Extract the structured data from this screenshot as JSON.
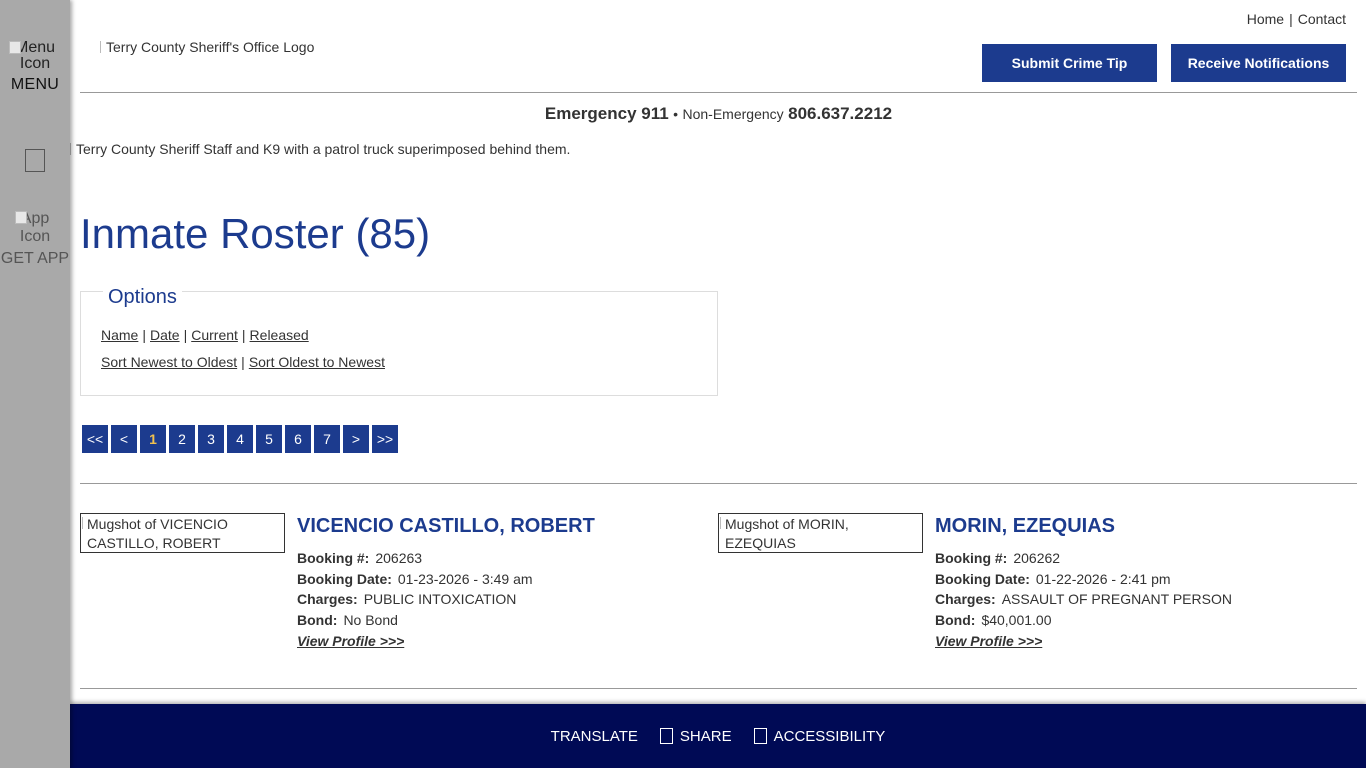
{
  "sidebar": {
    "menu_icon_alt": "Menu Icon",
    "menu_label": "MENU",
    "app_icon_alt": "App Icon",
    "app_label": "GET APP"
  },
  "header": {
    "links": [
      "Home",
      "Contact"
    ],
    "logo_alt": "Terry County Sheriff's Office Logo",
    "buttons": {
      "crime_tip": "Submit Crime Tip",
      "notifications": "Receive Notifications"
    },
    "emergency_label": "Emergency 911",
    "bullet": "•",
    "non_emergency_label": "Non-Emergency",
    "non_emergency_number": "806.637.2212",
    "hero_alt": "Terry County Sheriff Staff and K9 with a patrol truck superimposed behind them."
  },
  "main": {
    "title": "Inmate Roster (85)",
    "options": {
      "legend": "Options",
      "filters": [
        "Name",
        "Date",
        "Current",
        "Released"
      ],
      "sorts": [
        "Sort Newest to Oldest",
        "Sort Oldest to Newest"
      ]
    },
    "pagination": [
      "<<",
      "<",
      "1",
      "2",
      "3",
      "4",
      "5",
      "6",
      "7",
      ">",
      ">>"
    ],
    "active_page": "1",
    "inmates": [
      {
        "mugshot_alt": "Mugshot of VICENCIO CASTILLO, ROBERT",
        "name": "VICENCIO CASTILLO, ROBERT",
        "booking_label": "Booking #:",
        "booking_number": "206263",
        "date_label": "Booking Date:",
        "booking_date": "01-23-2026 - 3:49 am",
        "charges_label": "Charges:",
        "charges": "PUBLIC INTOXICATION",
        "bond_label": "Bond:",
        "bond": "No Bond",
        "view_label": "View Profile >>>"
      },
      {
        "mugshot_alt": "Mugshot of MORIN, EZEQUIAS",
        "name": "MORIN, EZEQUIAS",
        "booking_label": "Booking #:",
        "booking_number": "206262",
        "date_label": "Booking Date:",
        "booking_date": "01-22-2026 - 2:41 pm",
        "charges_label": "Charges:",
        "charges": "ASSAULT OF PREGNANT PERSON",
        "bond_label": "Bond:",
        "bond": "$40,001.00",
        "view_label": "View Profile >>>"
      }
    ]
  },
  "bottom_bar": {
    "translate": "TRANSLATE",
    "share": "SHARE",
    "accessibility": "ACCESSIBILITY"
  },
  "colors": {
    "brand_blue": "#1c3b8e",
    "bottom_bar": "#000a55",
    "sidebar": "#a9a9a9",
    "active_page": "#f2c14e"
  }
}
